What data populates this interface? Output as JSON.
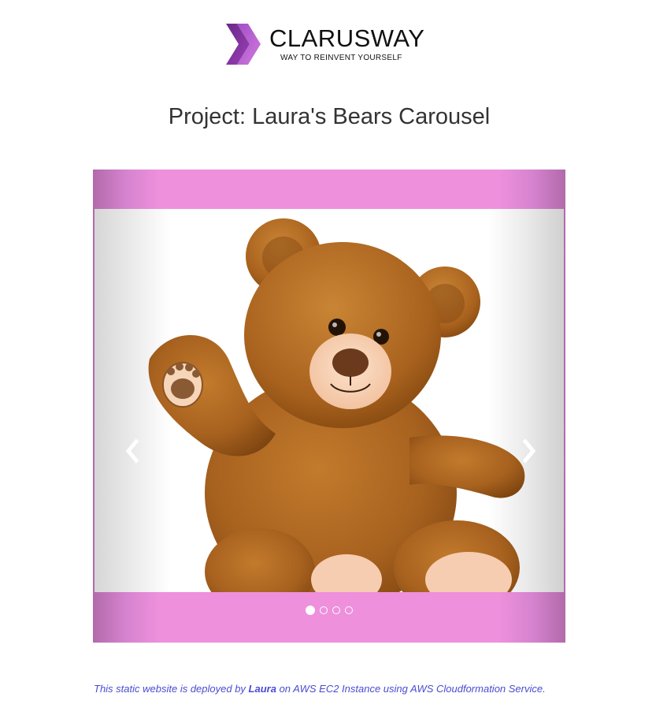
{
  "logo": {
    "name": "CLARUSWAY",
    "tagline": "WAY TO REINVENT YOURSELF",
    "colors": {
      "chevron_dark": "#7b2f8f",
      "chevron_light": "#c06ad6"
    }
  },
  "page": {
    "title": "Project: Laura's Bears Carousel"
  },
  "carousel": {
    "slide_count": 4,
    "active_index": 0,
    "prev_icon": "chevron-left-icon",
    "next_icon": "chevron-right-icon",
    "colors": {
      "band": "#ee90dc",
      "band_edge": "#b26aaa"
    }
  },
  "footer": {
    "text_before": "This static website is deployed by ",
    "author": "Laura",
    "text_after": " on AWS EC2 Instance using AWS Cloudformation Service.",
    "color": "#4b4bd2"
  }
}
